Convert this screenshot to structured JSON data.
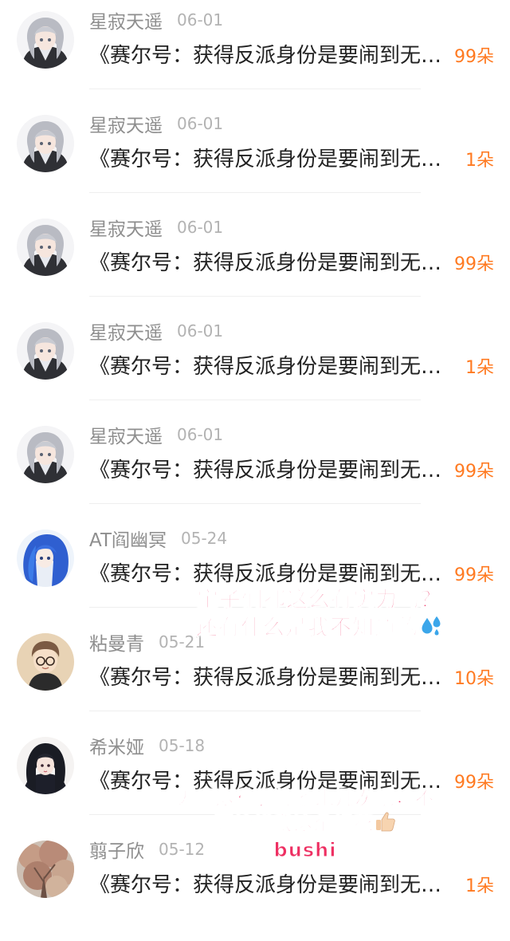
{
  "items": [
    {
      "name": "星寂天遥",
      "date": "06-01",
      "title": "《赛尔号：获得反派身份是要闹到无法无天吗》",
      "count": "99朵",
      "avatar": "anime-gray-hair-avatar"
    },
    {
      "name": "星寂天遥",
      "date": "06-01",
      "title": "《赛尔号：获得反派身份是要闹到无法无天吗》",
      "count": "1朵",
      "avatar": "anime-gray-hair-avatar"
    },
    {
      "name": "星寂天遥",
      "date": "06-01",
      "title": "《赛尔号：获得反派身份是要闹到无法无天吗》",
      "count": "99朵",
      "avatar": "anime-gray-hair-avatar"
    },
    {
      "name": "星寂天遥",
      "date": "06-01",
      "title": "《赛尔号：获得反派身份是要闹到无法无天吗》",
      "count": "1朵",
      "avatar": "anime-gray-hair-avatar"
    },
    {
      "name": "星寂天遥",
      "date": "06-01",
      "title": "《赛尔号：获得反派身份是要闹到无法无天吗》",
      "count": "99朵",
      "avatar": "anime-gray-hair-avatar"
    },
    {
      "name": "AT阎幽冥",
      "date": "05-24",
      "title": "《赛尔号：获得反派身份是要闹到无法无天吗》",
      "count": "99朵",
      "avatar": "anime-blue-hair-avatar"
    },
    {
      "name": "粘曼青",
      "date": "05-21",
      "title": "《赛尔号：获得反派身份是要闹到无法无天吗》",
      "count": "10朵",
      "avatar": "chibi-glasses-avatar"
    },
    {
      "name": "希米娅",
      "date": "05-18",
      "title": "《赛尔号：获得反派身份是要闹到无法无天吗》",
      "count": "99朵",
      "avatar": "anime-dark-hair-avatar"
    },
    {
      "name": "翦子欣",
      "date": "05-12",
      "title": "《赛尔号：获得反派身份是要闹到无法无天吗》",
      "count": "1朵",
      "avatar": "autumn-tree-avatar"
    }
  ],
  "captions": {
    "first": "宝子们都这么有实力吗？还有什么是我不知道的",
    "first_emoji": "sweat-droplets-emoji",
    "second_a": "天哪这种震惊多来几次吧，不要怜惜我这朵娇花",
    "second_emoji": "thumbs-up-emoji",
    "second_b": "（bushi）"
  },
  "colors": {
    "count": "#ff7a21",
    "caption": "#ee2f62",
    "name": "#8e8e8e",
    "date": "#b3b3b3",
    "title": "#222222"
  }
}
